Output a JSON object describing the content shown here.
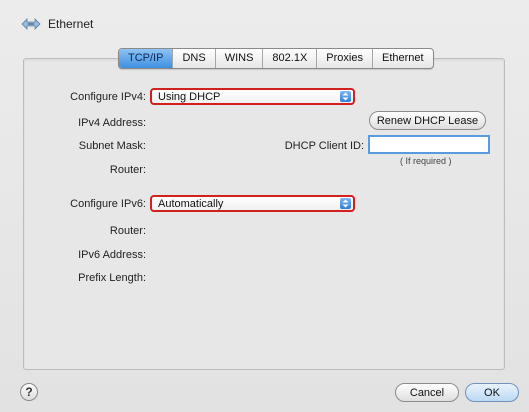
{
  "header": {
    "title": "Ethernet",
    "icon": "network-ethernet-icon"
  },
  "tabs": [
    {
      "label": "TCP/IP",
      "active": true
    },
    {
      "label": "DNS"
    },
    {
      "label": "WINS"
    },
    {
      "label": "802.1X"
    },
    {
      "label": "Proxies"
    },
    {
      "label": "Ethernet"
    }
  ],
  "ipv4": {
    "configure_label": "Configure IPv4:",
    "configure_value": "Using DHCP",
    "address_label": "IPv4 Address:",
    "subnet_label": "Subnet Mask:",
    "router_label": "Router:"
  },
  "dhcp": {
    "renew_label": "Renew DHCP Lease",
    "client_id_label": "DHCP Client ID:",
    "client_id_value": "",
    "client_id_hint": "( If required )"
  },
  "ipv6": {
    "configure_label": "Configure IPv6:",
    "configure_value": "Automatically",
    "router_label": "Router:",
    "address_label": "IPv6 Address:",
    "prefix_label": "Prefix Length:"
  },
  "footer": {
    "help": "?",
    "cancel_label": "Cancel",
    "ok_label": "OK"
  },
  "colors": {
    "highlight": "#d0211e",
    "accent": "#3f8fe0"
  }
}
